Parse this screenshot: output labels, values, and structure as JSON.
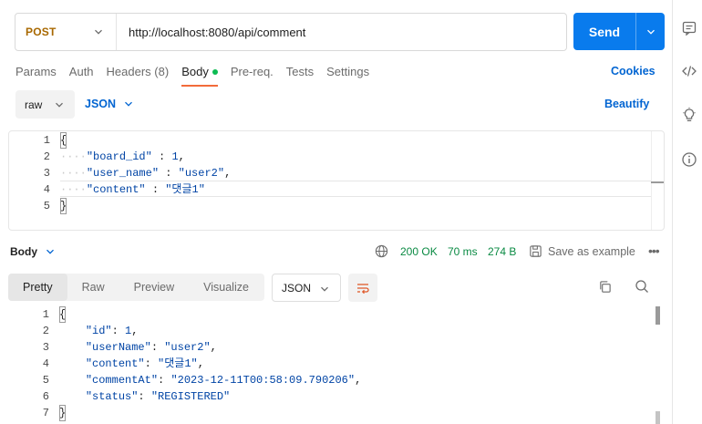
{
  "request": {
    "method": "POST",
    "url": "http://localhost:8080/api/comment",
    "send_label": "Send",
    "colors": {
      "method": "#a86800",
      "send": "#097bed",
      "accent": "#0265d2"
    }
  },
  "tabs": [
    {
      "label": "Params"
    },
    {
      "label": "Auth"
    },
    {
      "label": "Headers (8)"
    },
    {
      "label": "Body"
    },
    {
      "label": "Pre-req."
    },
    {
      "label": "Tests"
    },
    {
      "label": "Settings"
    }
  ],
  "cookies_label": "Cookies",
  "body_mode": "raw",
  "body_lang": "JSON",
  "beautify_label": "Beautify",
  "request_body": {
    "line_numbers": [
      "1",
      "2",
      "3",
      "4",
      "5"
    ],
    "open": "{",
    "close": "}",
    "fields": [
      {
        "key": "\"board_id\"",
        "sep": " : ",
        "value": "1",
        "tail": ","
      },
      {
        "key": "\"user_name\"",
        "sep": " : ",
        "value": "\"user2\"",
        "tail": ","
      },
      {
        "key": "\"content\"",
        "sep": " : ",
        "value": "\"댓글1\"",
        "tail": ""
      }
    ]
  },
  "response": {
    "body_label": "Body",
    "status": "200 OK",
    "time": "70 ms",
    "size": "274 B",
    "save_label": "Save as example",
    "more": "•••",
    "tabs": [
      {
        "label": "Pretty"
      },
      {
        "label": "Raw"
      },
      {
        "label": "Preview"
      },
      {
        "label": "Visualize"
      }
    ],
    "lang": "JSON",
    "line_numbers": [
      "1",
      "2",
      "3",
      "4",
      "5",
      "6",
      "7"
    ],
    "open": "{",
    "close": "}",
    "fields": [
      {
        "key": "\"id\"",
        "sep": ": ",
        "value": "1",
        "tail": ","
      },
      {
        "key": "\"userName\"",
        "sep": ": ",
        "value": "\"user2\"",
        "tail": ","
      },
      {
        "key": "\"content\"",
        "sep": ": ",
        "value": "\"댓글1\"",
        "tail": ","
      },
      {
        "key": "\"commentAt\"",
        "sep": ": ",
        "value": "\"2023-12-11T00:58:09.790206\"",
        "tail": ","
      },
      {
        "key": "\"status\"",
        "sep": ": ",
        "value": "\"REGISTERED\"",
        "tail": ""
      }
    ]
  },
  "icons": [
    "chevron-down-icon",
    "globe-icon",
    "save-icon",
    "wrap-lines-icon",
    "copy-icon",
    "search-icon",
    "comment-icon",
    "code-icon",
    "lightbulb-icon",
    "info-icon"
  ]
}
